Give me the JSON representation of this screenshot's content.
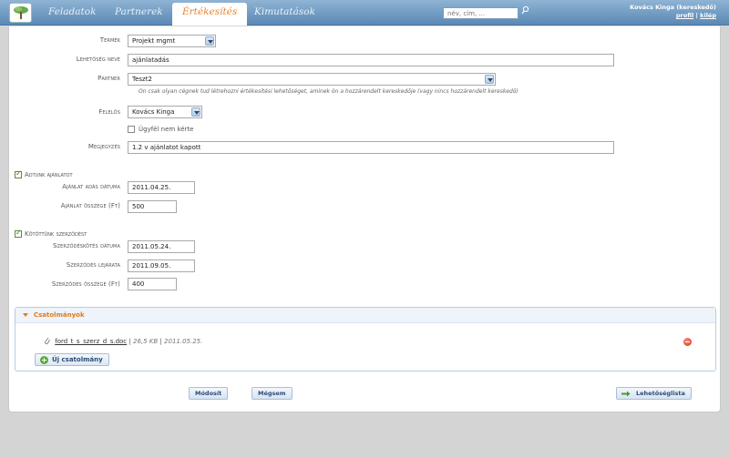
{
  "nav": {
    "tabs": [
      {
        "label": "Feladatok"
      },
      {
        "label": "Partnerek"
      },
      {
        "label": "Értékesítés"
      },
      {
        "label": "Kimutatások"
      }
    ],
    "search_placeholder": "név, cím, ...",
    "user_name": "Kovács Kinga (kereskedő)",
    "profile_link": "profil",
    "logout_link": "kilép"
  },
  "form": {
    "termek_label": "Termék",
    "termek_value": "Projekt mgmt",
    "lehetoseg_label": "Lehetőség neve",
    "lehetoseg_value": "ajánlatadás",
    "partner_label": "Partner",
    "partner_value": "Teszt2",
    "partner_hint": "On csak olyan cégnek tud létrehozni értékesítési lehetőséget, aminek ön a hozzárendelt kereskedője (vagy nincs hozzárendelt kereskedő)",
    "felelos_label": "Felelős",
    "felelos_value": "Kovács Kinga",
    "ugyfel_label": "Ügyfél nem kérte",
    "megjegyzes_label": "Megjegyzés",
    "megjegyzes_value": "1.2 v ajánlatot kapott"
  },
  "offer": {
    "checkbox_label": "Adtunk ajánlatot",
    "date_label": "Ajánlat adás dátuma",
    "date_value": "2011.04.25.",
    "amount_label": "Ajánlat összege (Ft)",
    "amount_value": "500"
  },
  "contract": {
    "checkbox_label": "Kötöttünk szerződést",
    "date_label": "Szerződéskötés dátuma",
    "date_value": "2011.05.24.",
    "expiry_label": "Szerződés lejárata",
    "expiry_value": "2011.09.05.",
    "amount_label": "Szerződés összege (Ft)",
    "amount_value": "400"
  },
  "attachments": {
    "title": "Csatolmányok",
    "file_name": "ford_t_s_szerz_d_s.doc",
    "file_size": "26,5 KB",
    "file_date": "2011.05.25.",
    "new_button": "Új csatolmány"
  },
  "actions": {
    "modify": "Módosít",
    "cancel": "Mégsem",
    "list": "Lehetőséglista"
  },
  "colors": {
    "accent": "#e07b20",
    "header": "#5a88b4"
  }
}
